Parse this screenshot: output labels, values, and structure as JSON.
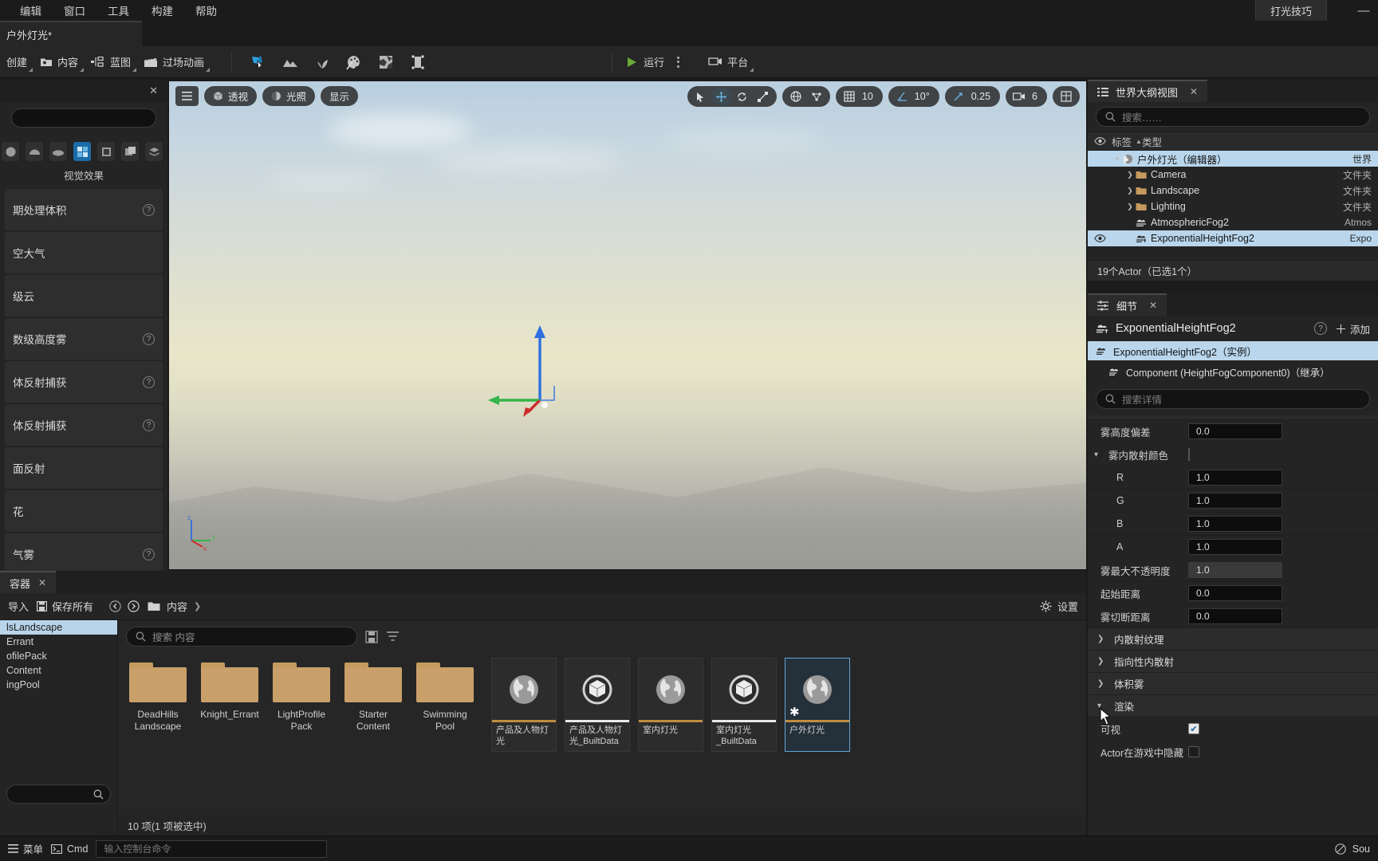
{
  "menubar": {
    "items": [
      "编辑",
      "窗口",
      "工具",
      "构建",
      "帮助"
    ],
    "tip_button": "打光技巧",
    "minimize": "—"
  },
  "level_tab": {
    "title": "户外灯光*"
  },
  "toolbar": {
    "create_label": "创建",
    "content_label": "内容",
    "blueprint_label": "蓝图",
    "cinematics_label": "过场动画",
    "play_label": "运行",
    "platform_label": "平台",
    "mode_icons": [
      "select-mode-icon",
      "landscape-mode-icon",
      "foliage-mode-icon",
      "mesh-paint-mode-icon",
      "fracture-mode-icon",
      "modeling-mode-icon"
    ]
  },
  "left_panel": {
    "caption": "视觉效果",
    "rows": [
      {
        "label": "期处理体积"
      },
      {
        "label": "空大气"
      },
      {
        "label": "级云"
      },
      {
        "label": "数级高度雾"
      },
      {
        "label": "体反射捕获"
      },
      {
        "label": "体反射捕获"
      },
      {
        "label": "面反射"
      },
      {
        "label": "花"
      },
      {
        "label": "气雾"
      }
    ]
  },
  "viewport": {
    "menu_icon": "hamburger-icon",
    "perspective_label": "透视",
    "lighting_label": "光照",
    "show_label": "显示",
    "grid_snap_value": "10",
    "angle_snap_value": "10°",
    "scale_snap_value": "0.25",
    "camera_speed_value": "6",
    "axis_labels": {
      "z": "z",
      "y": "y",
      "x": "x"
    }
  },
  "outliner": {
    "tab_title": "世界大纲视图",
    "search_placeholder": "搜索……",
    "column_label": "标签",
    "column_type": "类型",
    "sort_arrow": "▲",
    "rows": [
      {
        "name": "户外灯光（编辑器）",
        "type": "世界",
        "depth": 0,
        "icon": "world-icon",
        "expandable": true,
        "selected": true,
        "eye": false
      },
      {
        "name": "Camera",
        "type": "文件夹",
        "depth": 1,
        "icon": "folder-icon",
        "expandable": true,
        "selected": false,
        "eye": false
      },
      {
        "name": "Landscape",
        "type": "文件夹",
        "depth": 1,
        "icon": "folder-icon",
        "expandable": true,
        "selected": false,
        "eye": false
      },
      {
        "name": "Lighting",
        "type": "文件夹",
        "depth": 1,
        "icon": "folder-icon",
        "expandable": true,
        "selected": false,
        "eye": false
      },
      {
        "name": "AtmosphericFog2",
        "type": "Atmos",
        "depth": 1,
        "icon": "fog-icon",
        "expandable": false,
        "selected": false,
        "eye": false
      },
      {
        "name": "ExponentialHeightFog2",
        "type": "Expo",
        "depth": 1,
        "icon": "fog-icon",
        "expandable": false,
        "selected": true,
        "eye": true
      }
    ],
    "status": "19个Actor（已选1个）"
  },
  "details": {
    "tab_title": "细节",
    "actor_name": "ExponentialHeightFog2",
    "add_label": "添加",
    "instance_row": "ExponentialHeightFog2（实例）",
    "component_row": "Component (HeightFogComponent0)（继承）",
    "search_placeholder": "搜索详情",
    "properties": [
      {
        "label": "雾高度偏差",
        "value": "0.0",
        "kind": "input",
        "indent": false
      },
      {
        "label": "雾内散射颜色",
        "value": "#ffffff",
        "kind": "color",
        "indent": false,
        "twist": "▾"
      },
      {
        "label": "R",
        "value": "1.0",
        "kind": "input",
        "indent": true
      },
      {
        "label": "G",
        "value": "1.0",
        "kind": "input",
        "indent": true
      },
      {
        "label": "B",
        "value": "1.0",
        "kind": "input",
        "indent": true
      },
      {
        "label": "A",
        "value": "1.0",
        "kind": "input",
        "indent": true
      },
      {
        "label": "雾最大不透明度",
        "value": "1.0",
        "kind": "input-gray",
        "indent": false
      },
      {
        "label": "起始距离",
        "value": "0.0",
        "kind": "input",
        "indent": false
      },
      {
        "label": "雾切断距离",
        "value": "0.0",
        "kind": "input",
        "indent": false
      }
    ],
    "categories": [
      {
        "label": "内散射纹理",
        "twist": "›"
      },
      {
        "label": "指向性内散射",
        "twist": "›"
      },
      {
        "label": "体积雾",
        "twist": "›"
      },
      {
        "label": "渲染",
        "twist": "▾"
      }
    ],
    "render_rows": [
      {
        "label": "可视",
        "checked": true
      },
      {
        "label": "Actor在游戏中隐藏",
        "checked": false
      }
    ]
  },
  "content_browser": {
    "tab_title": "容器",
    "import_label": "导入",
    "save_all_label": "保存所有",
    "breadcrumb_root": "内容",
    "settings_label": "设置",
    "search_placeholder": "搜索 内容",
    "tree_items": [
      "lsLandscape",
      "Errant",
      "ofilePack",
      "Content",
      "ingPool"
    ],
    "tree_selected_index": 0,
    "folders": [
      {
        "name": "DeadHills\nLandscape"
      },
      {
        "name": "Knight_Errant"
      },
      {
        "name": "LightProfile\nPack"
      },
      {
        "name": "Starter\nContent"
      },
      {
        "name": "Swimming\nPool"
      }
    ],
    "assets": [
      {
        "name": "产品及人物灯光",
        "icon": "world-icon",
        "strip": "orange",
        "selected": false,
        "star": false
      },
      {
        "name": "产品及人物灯光_BuiltData",
        "icon": "cube-icon",
        "strip": "white",
        "selected": false,
        "star": false
      },
      {
        "name": "室内灯光",
        "icon": "world-icon",
        "strip": "orange",
        "selected": false,
        "star": false
      },
      {
        "name": "室内灯光_BuiltData",
        "icon": "cube-icon",
        "strip": "white",
        "selected": false,
        "star": false
      },
      {
        "name": "户外灯光",
        "icon": "world-icon",
        "strip": "orange",
        "selected": true,
        "star": true
      }
    ],
    "status": "10 项(1 项被选中)"
  },
  "statusbar": {
    "menu_label": "菜单",
    "cmd_label": "Cmd",
    "cmd_placeholder": "输入控制台命令",
    "source_label": "Sou"
  }
}
